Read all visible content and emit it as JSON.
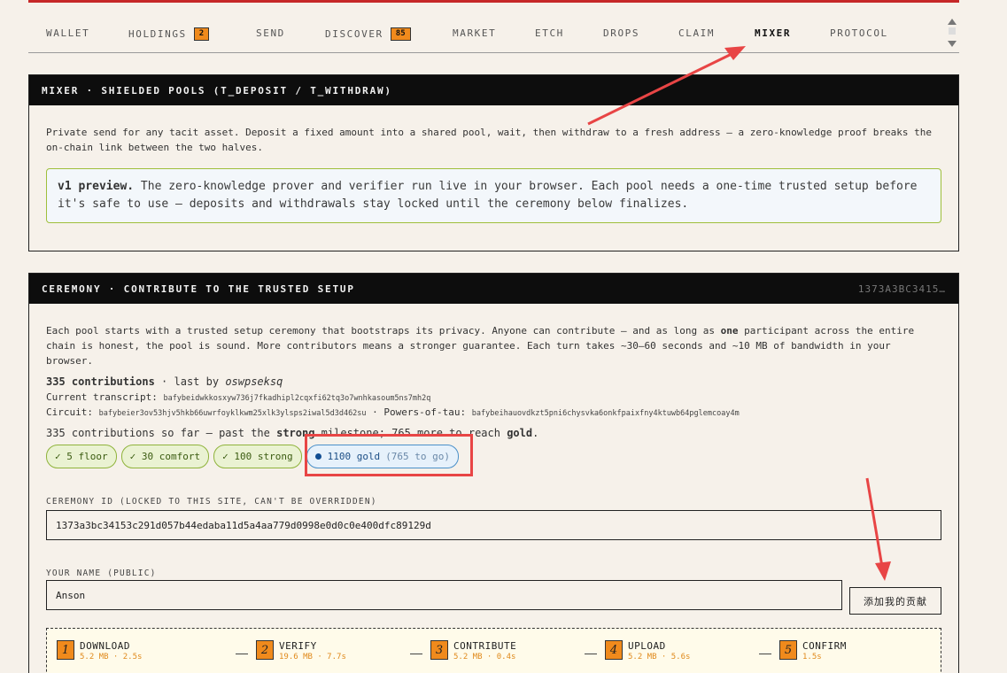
{
  "nav": {
    "items": [
      {
        "label": "WALLET",
        "badge": ""
      },
      {
        "label": "HOLDINGS",
        "badge": "2"
      },
      {
        "label": "SEND",
        "badge": ""
      },
      {
        "label": "DISCOVER",
        "badge": "85"
      },
      {
        "label": "MARKET",
        "badge": ""
      },
      {
        "label": "ETCH",
        "badge": ""
      },
      {
        "label": "DROPS",
        "badge": ""
      },
      {
        "label": "CLAIM",
        "badge": ""
      },
      {
        "label": "MIXER",
        "badge": ""
      },
      {
        "label": "PROTOCOL",
        "badge": ""
      }
    ],
    "active": "MIXER"
  },
  "mixer": {
    "title": "MIXER · SHIELDED POOLS (T_DEPOSIT / T_WITHDRAW)",
    "description": "Private send for any tacit asset. Deposit a fixed amount into a shared pool, wait, then withdraw to a fresh address — a zero-knowledge proof breaks the on-chain link between the two halves.",
    "notice_bold": "v1 preview.",
    "notice_text": " The zero-knowledge prover and verifier run live in your browser. Each pool needs a one-time trusted setup before it's safe to use — deposits and withdrawals stay locked until the ceremony below finalizes."
  },
  "ceremony": {
    "title": "CEREMONY · CONTRIBUTE TO THE TRUSTED SETUP",
    "hash_short": "1373A3BC3415…",
    "description_a": "Each pool starts with a trusted setup ceremony that bootstraps its privacy. Anyone can contribute — and as long as ",
    "description_bold": "one",
    "description_b": " participant across the entire chain is honest, the pool is sound. More contributors means a stronger guarantee. Each turn takes ~30–60 seconds and ~10 MB of bandwidth in your browser.",
    "contributions_count": "335 contributions",
    "last_by_label": " · last by ",
    "last_by": "oswpseksq",
    "transcript_label": "Current transcript: ",
    "transcript": "bafybeidwkkosxyw736j7fkadhipl2cqxfi62tq3o7wnhkasoum5ns7mh2q",
    "circuit_label": "Circuit: ",
    "circuit": "bafybeier3ov53hjv5hkb66uwrfoyklkwm25xlk3ylsps2iwal5d3d462su",
    "tau_label": " · Powers-of-tau: ",
    "tau": "bafybeihauovdkzt5pni6chysvka6onkfpaixfny4ktuwb64pglemcoay4m",
    "milestone_a": "335 contributions so far — past the ",
    "milestone_bold1": "strong",
    "milestone_b": " milestone; 765 more to reach ",
    "milestone_bold2": "gold",
    "milestone_c": ".",
    "milestones": [
      {
        "label": "✓ 5 floor"
      },
      {
        "label": "✓ 30 comfort"
      },
      {
        "label": "✓ 100 strong"
      }
    ],
    "current_milestone": {
      "label": "1100 gold",
      "togo": "(765 to go)"
    },
    "ceremony_id_label": "CEREMONY ID (LOCKED TO THIS SITE, CAN'T BE OVERRIDDEN)",
    "ceremony_id": "1373a3bc34153c291d057b44edaba11d5a4aa779d0998e0d0c0e400dfc89129d",
    "name_label": "YOUR NAME (PUBLIC)",
    "name_value": "Anson",
    "add_button": "添加我的贡献",
    "steps": [
      {
        "num": "1",
        "name": "DOWNLOAD",
        "sub": "5.2 MB · 2.5s"
      },
      {
        "num": "2",
        "name": "VERIFY",
        "sub": "19.6 MB · 7.7s"
      },
      {
        "num": "3",
        "name": "CONTRIBUTE",
        "sub": "5.2 MB · 0.4s"
      },
      {
        "num": "4",
        "name": "UPLOAD",
        "sub": "5.2 MB · 5.6s"
      },
      {
        "num": "5",
        "name": "CONFIRM",
        "sub": "1.5s"
      }
    ]
  },
  "colors": {
    "accent": "#f08a1c",
    "annotation": "#e84545",
    "panel_head": "#0d0d0d"
  }
}
